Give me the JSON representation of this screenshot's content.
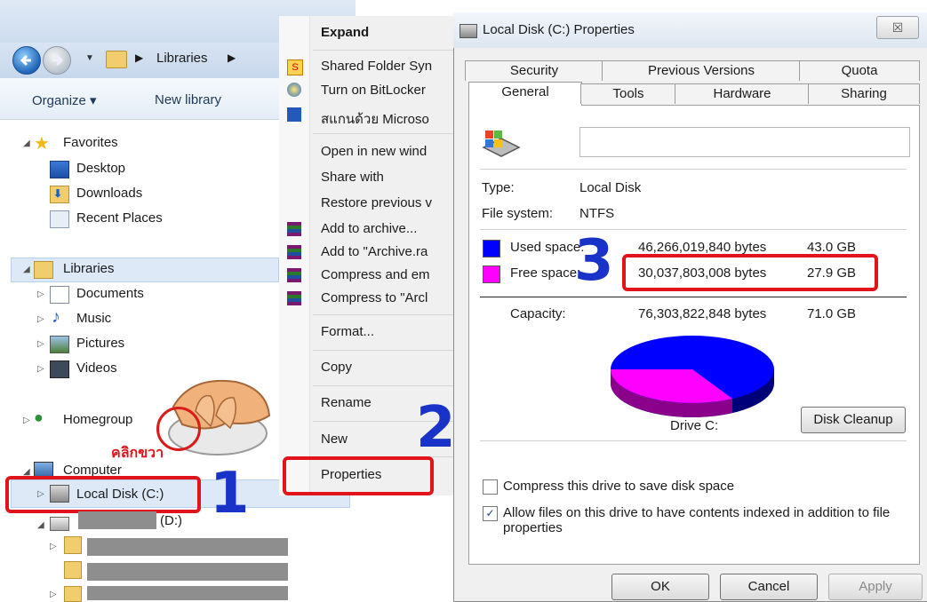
{
  "explorer": {
    "breadcrumb": "Libraries",
    "toolbar": {
      "organize": "Organize ▾",
      "new_library": "New library"
    },
    "tree": {
      "favorites": "Favorites",
      "desktop": "Desktop",
      "downloads": "Downloads",
      "recent_places": "Recent Places",
      "libraries": "Libraries",
      "documents": "Documents",
      "music": "Music",
      "pictures": "Pictures",
      "videos": "Videos",
      "homegroup": "Homegroup",
      "computer": "Computer",
      "local_disk": "Local Disk (C:)",
      "drive_d": "(D:)"
    }
  },
  "context_menu": {
    "items": [
      "Expand",
      "Shared Folder Syn",
      "Turn on BitLocker",
      "สแกนด้วย Microso",
      "Open in new wind",
      "Share with",
      "Restore previous v",
      "Add to archive...",
      "Add to \"Archive.ra",
      "Compress and em",
      "Compress to \"Arcl",
      "Format...",
      "Copy",
      "Rename",
      "New",
      "Properties"
    ]
  },
  "dialog": {
    "title": "Local Disk (C:) Properties",
    "close": "☒",
    "tabs_top": [
      "Security",
      "Previous Versions",
      "Quota"
    ],
    "tabs_bottom": [
      "General",
      "Tools",
      "Hardware",
      "Sharing"
    ],
    "type_label": "Type:",
    "type_value": "Local Disk",
    "fs_label": "File system:",
    "fs_value": "NTFS",
    "used": {
      "label": "Used space:",
      "bytes": "46,266,019,840 bytes",
      "gb": "43.0 GB",
      "color": "#0000ff"
    },
    "free": {
      "label": "Free space:",
      "bytes": "30,037,803,008 bytes",
      "gb": "27.9 GB",
      "color": "#ff00ff"
    },
    "capacity": {
      "label": "Capacity:",
      "bytes": "76,303,822,848 bytes",
      "gb": "71.0 GB"
    },
    "drive_label": "Drive C:",
    "disk_cleanup": "Disk Cleanup",
    "compress_label": "Compress this drive to save disk space",
    "index_label": "Allow files on this drive to have contents indexed in addition to file properties",
    "ok": "OK",
    "cancel": "Cancel",
    "apply": "Apply"
  },
  "annotations": {
    "right_click": "คลิกขวา",
    "step1": "1",
    "step2": "2",
    "step3": "3"
  }
}
